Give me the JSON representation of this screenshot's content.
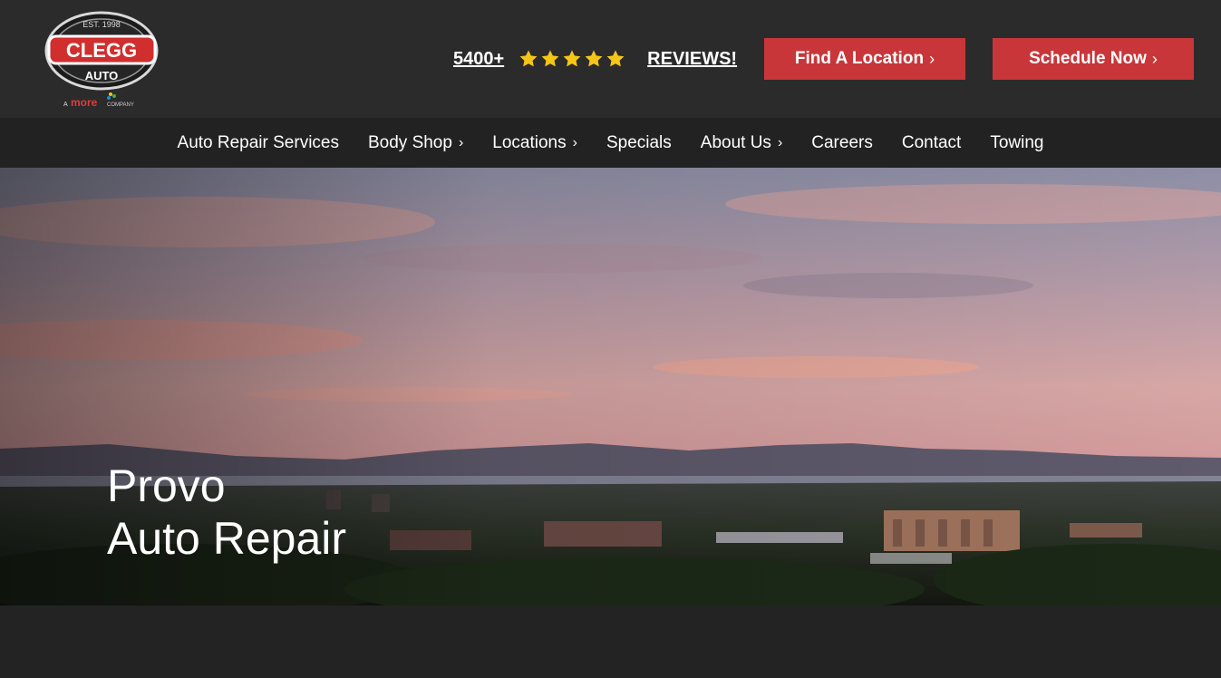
{
  "brand": {
    "logo_lines": [
      "EST. 1998",
      "CLEGG",
      "AUTO"
    ],
    "tagline_prefix": "A",
    "tagline_brand": "more",
    "tagline_suffix": "COMPANY"
  },
  "reviews": {
    "count": "5400+",
    "rating": 5,
    "label": "REVIEWS!",
    "star_color": "#f5c518"
  },
  "cta": {
    "find_location": "Find A Location",
    "schedule_now": "Schedule Now",
    "chevron": "›",
    "color": "#c8363a"
  },
  "nav": {
    "items": [
      {
        "label": "Auto Repair Services",
        "chevron": ""
      },
      {
        "label": "Body Shop",
        "chevron": "›"
      },
      {
        "label": "Locations",
        "chevron": "›"
      },
      {
        "label": "Specials",
        "chevron": ""
      },
      {
        "label": "About Us",
        "chevron": "›"
      },
      {
        "label": "Careers",
        "chevron": ""
      },
      {
        "label": "Contact",
        "chevron": ""
      },
      {
        "label": "Towing",
        "chevron": ""
      }
    ]
  },
  "hero": {
    "title_line1": "Provo",
    "title_line2": "Auto Repair"
  }
}
